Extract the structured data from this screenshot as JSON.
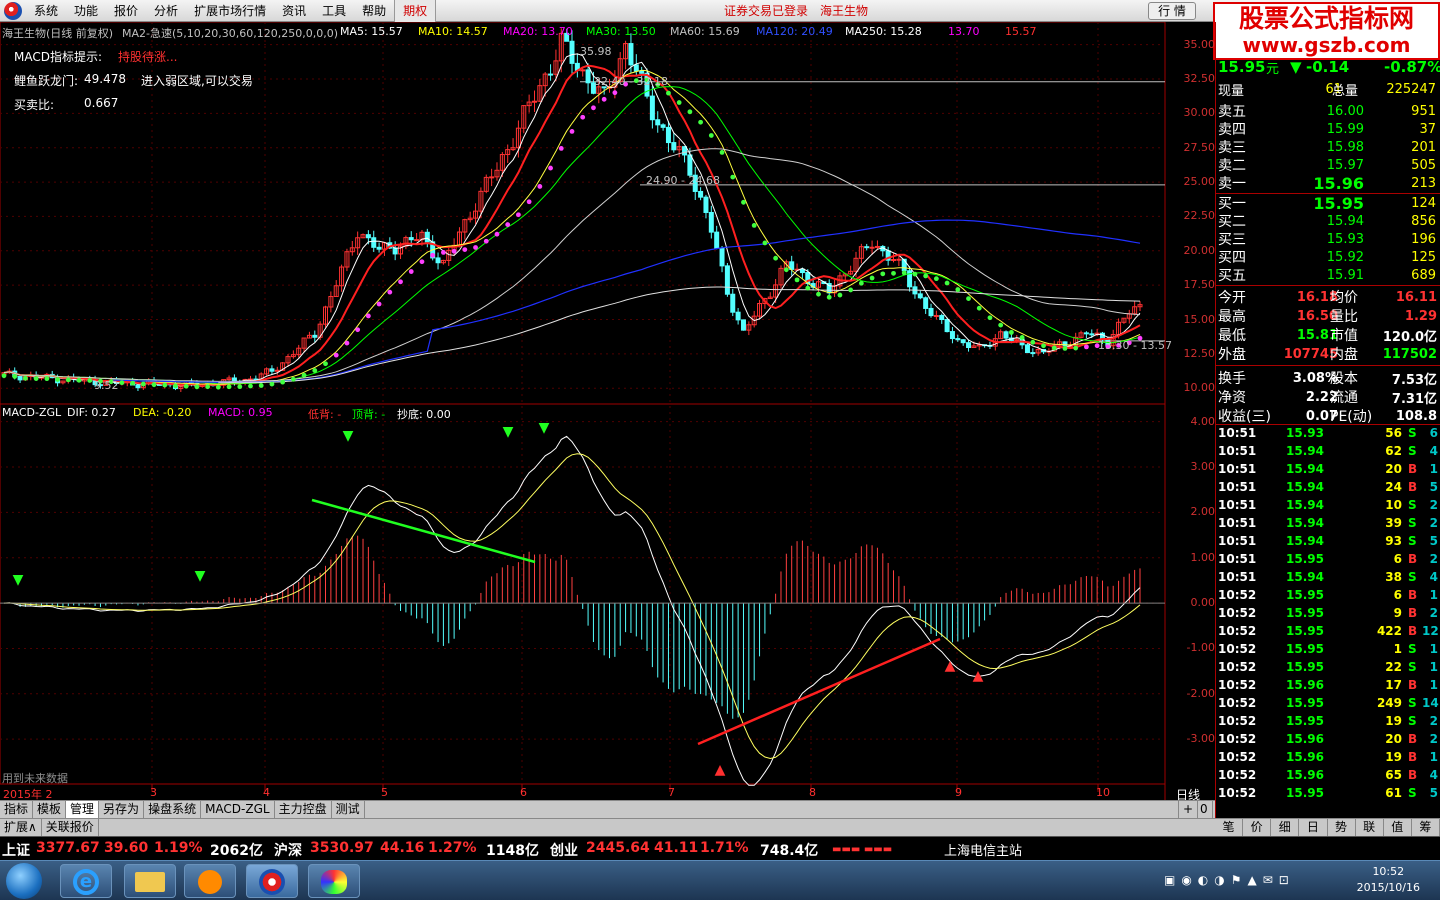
{
  "menu": {
    "items": [
      "系统",
      "功能",
      "报价",
      "分析",
      "扩展市场行情",
      "资讯",
      "工具",
      "帮助",
      "期权"
    ],
    "center_status": "证券交易已登录",
    "center_stock": "海王生物",
    "quote_btn": "行 情"
  },
  "watermark": {
    "line1": "股票公式指标网",
    "line2": "www.gszb.com"
  },
  "chart_header": {
    "title": "海王生物(日线 前复权)",
    "ma_name": "MA2-急速(5,10,20,30,60,120,250,0,0,0)",
    "ma5": "MA5: 15.57",
    "ma10": "MA10: 14.57",
    "ma20": "MA20: 13.70",
    "ma30": "MA30: 13.50",
    "ma60": "MA60: 15.69",
    "ma120": "MA120: 20.49",
    "ma250": "MA250: 15.28",
    "extra1": "13.70",
    "extra2": "15.57"
  },
  "left_info": {
    "macd_hint_label": "MACD指标提示:",
    "macd_hint_val": "持股待涨...",
    "liyu_label": "鲤鱼跃龙门:",
    "liyu_val": "49.478",
    "liyu_note": "进入弱区域,可以交易",
    "mmb_label": "买卖比:",
    "mmb_val": "0.667"
  },
  "price_annotations": {
    "high": "35.98",
    "l1": "32.40 - 32.18",
    "l2": "24.90 - 24.68",
    "low": "9.52",
    "l3": "13.30 - 13.57"
  },
  "price_axis": [
    "35.00",
    "32.50",
    "30.00",
    "27.50",
    "25.00",
    "22.50",
    "20.00",
    "17.50",
    "15.00",
    "12.50",
    "10.00"
  ],
  "macd_header": {
    "name": "MACD-ZGL",
    "dif": "DIF: 0.27",
    "dea": "DEA: -0.20",
    "macd": "MACD: 0.95",
    "dibei": "低背: -",
    "dingbei": "顶背: -",
    "chaodi": "抄底: 0.00"
  },
  "macd_axis": [
    "4.00",
    "3.00",
    "2.00",
    "1.00",
    "0.00",
    "-1.00",
    "-2.00",
    "-3.00"
  ],
  "future_note": "用到未来数据",
  "date_axis": {
    "year": "2015年 2",
    "months": [
      "3",
      "4",
      "5",
      "6",
      "7",
      "8",
      "9",
      "10"
    ],
    "period": "日线"
  },
  "bottom_tabs": [
    "指标",
    "模板",
    "管理",
    "另存为",
    "操盘系统",
    "MACD-ZGL",
    "主力控盘",
    "测试"
  ],
  "bottom_tabs2": [
    "扩展∧",
    "关联报价"
  ],
  "pager": {
    "plus": "+",
    "zero": "0"
  },
  "quote": {
    "price": "15.95",
    "unit": "元",
    "change": "-0.14",
    "pct": "-0.87%",
    "xianliang_label": "现量",
    "xianliang": "61",
    "zongliang_label": "总量",
    "zongliang": "225247",
    "sells": [
      {
        "label": "卖五",
        "price": "16.00",
        "vol": "951"
      },
      {
        "label": "卖四",
        "price": "15.99",
        "vol": "37"
      },
      {
        "label": "卖三",
        "price": "15.98",
        "vol": "201"
      },
      {
        "label": "卖二",
        "price": "15.97",
        "vol": "505"
      },
      {
        "label": "卖一",
        "price": "15.96",
        "vol": "213"
      }
    ],
    "buys": [
      {
        "label": "买一",
        "price": "15.95",
        "vol": "124"
      },
      {
        "label": "买二",
        "price": "15.94",
        "vol": "856"
      },
      {
        "label": "买三",
        "price": "15.93",
        "vol": "196"
      },
      {
        "label": "买四",
        "price": "15.92",
        "vol": "125"
      },
      {
        "label": "买五",
        "price": "15.91",
        "vol": "689"
      }
    ],
    "stats": [
      {
        "l1": "今开",
        "v1": "16.18",
        "l2": "均价",
        "v2": "16.11"
      },
      {
        "l1": "最高",
        "v1": "16.50",
        "l2": "量比",
        "v2": "1.29"
      },
      {
        "l1": "最低",
        "v1": "15.81",
        "l2": "市值",
        "v2": "120.0亿"
      },
      {
        "l1": "外盘",
        "v1": "107745",
        "l2": "内盘",
        "v2": "117502"
      },
      {
        "l1": "换手",
        "v1": "3.08%",
        "l2": "股本",
        "v2": "7.53亿"
      },
      {
        "l1": "净资",
        "v1": "2.22",
        "l2": "流通",
        "v2": "7.31亿"
      },
      {
        "l1": "收益(三)",
        "v1": "0.07",
        "l2": "PE(动)",
        "v2": "108.8"
      }
    ]
  },
  "ticks": [
    [
      "10:51",
      "15.93",
      "56",
      "S",
      "6"
    ],
    [
      "10:51",
      "15.94",
      "62",
      "S",
      "4"
    ],
    [
      "10:51",
      "15.94",
      "20",
      "B",
      "1"
    ],
    [
      "10:51",
      "15.94",
      "24",
      "B",
      "5"
    ],
    [
      "10:51",
      "15.94",
      "10",
      "S",
      "2"
    ],
    [
      "10:51",
      "15.94",
      "39",
      "S",
      "2"
    ],
    [
      "10:51",
      "15.94",
      "93",
      "S",
      "5"
    ],
    [
      "10:51",
      "15.95",
      "6",
      "B",
      "2"
    ],
    [
      "10:51",
      "15.94",
      "38",
      "S",
      "4"
    ],
    [
      "10:52",
      "15.95",
      "6",
      "B",
      "1"
    ],
    [
      "10:52",
      "15.95",
      "9",
      "B",
      "2"
    ],
    [
      "10:52",
      "15.95",
      "422",
      "B",
      "12"
    ],
    [
      "10:52",
      "15.95",
      "1",
      "S",
      "1"
    ],
    [
      "10:52",
      "15.95",
      "22",
      "S",
      "1"
    ],
    [
      "10:52",
      "15.96",
      "17",
      "B",
      "1"
    ],
    [
      "10:52",
      "15.95",
      "249",
      "S",
      "14"
    ],
    [
      "10:52",
      "15.95",
      "19",
      "S",
      "2"
    ],
    [
      "10:52",
      "15.96",
      "20",
      "B",
      "2"
    ],
    [
      "10:52",
      "15.96",
      "19",
      "B",
      "1"
    ],
    [
      "10:52",
      "15.96",
      "65",
      "B",
      "4"
    ],
    [
      "10:52",
      "15.95",
      "61",
      "S",
      "5"
    ]
  ],
  "right_tabs": [
    "笔",
    "价",
    "细",
    "日",
    "势",
    "联",
    "值",
    "筹"
  ],
  "status_bar": {
    "sh_label": "上证",
    "sh_val": "3377.67",
    "sh_chg": "39.60",
    "sh_pct": "1.19%",
    "sh_amt": "2062亿",
    "sz_label": "沪深",
    "sz_val": "3530.97",
    "sz_chg": "44.16",
    "sz_pct": "1.27%",
    "sz_amt": "1148亿",
    "cy_label": "创业",
    "cy_val": "2445.64",
    "cy_chg": "41.11",
    "cy_pct": "1.71%",
    "cy_amt": "748.4亿",
    "server": "上海电信主站"
  },
  "clock": {
    "time": "10:52",
    "date": "2015/10/16"
  },
  "colors": {
    "up": "#ff3232",
    "down": "#54ffff",
    "ma5": "#ffffff",
    "ma10": "#ffff00",
    "ma20": "#ff00ff",
    "ma30": "#00ff00",
    "ma60": "#c0c0c0",
    "ma120": "#0000ff"
  },
  "chart_data": {
    "type": "candlestick",
    "price_range": [
      9,
      36.5
    ],
    "macd_range": [
      -3.9,
      4.3
    ]
  }
}
